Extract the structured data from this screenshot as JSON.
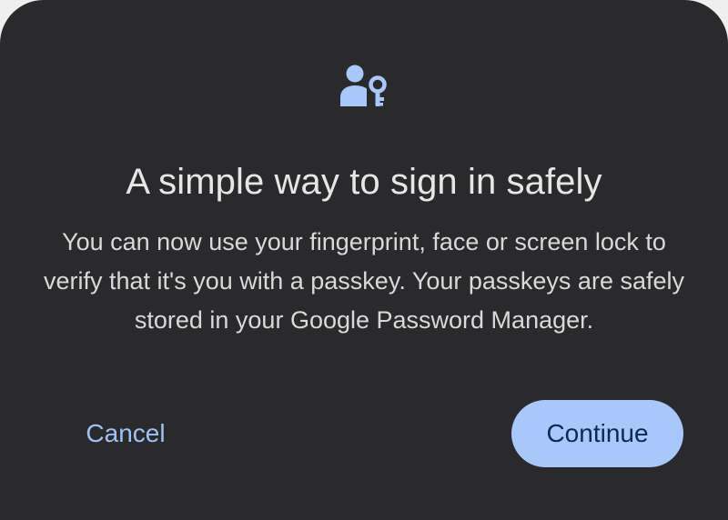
{
  "dialog": {
    "icon": "person-key-icon",
    "title": "A simple way to sign in safely",
    "body": "You can now use your fingerprint, face or screen lock to verify that it's you with a passkey. Your passkeys are safely stored in your Google Password Manager.",
    "cancel_label": "Cancel",
    "continue_label": "Continue"
  },
  "colors": {
    "sheet_background": "#2a2a2d",
    "accent": "#a8c7fa",
    "link_text": "#9fc2f5"
  }
}
